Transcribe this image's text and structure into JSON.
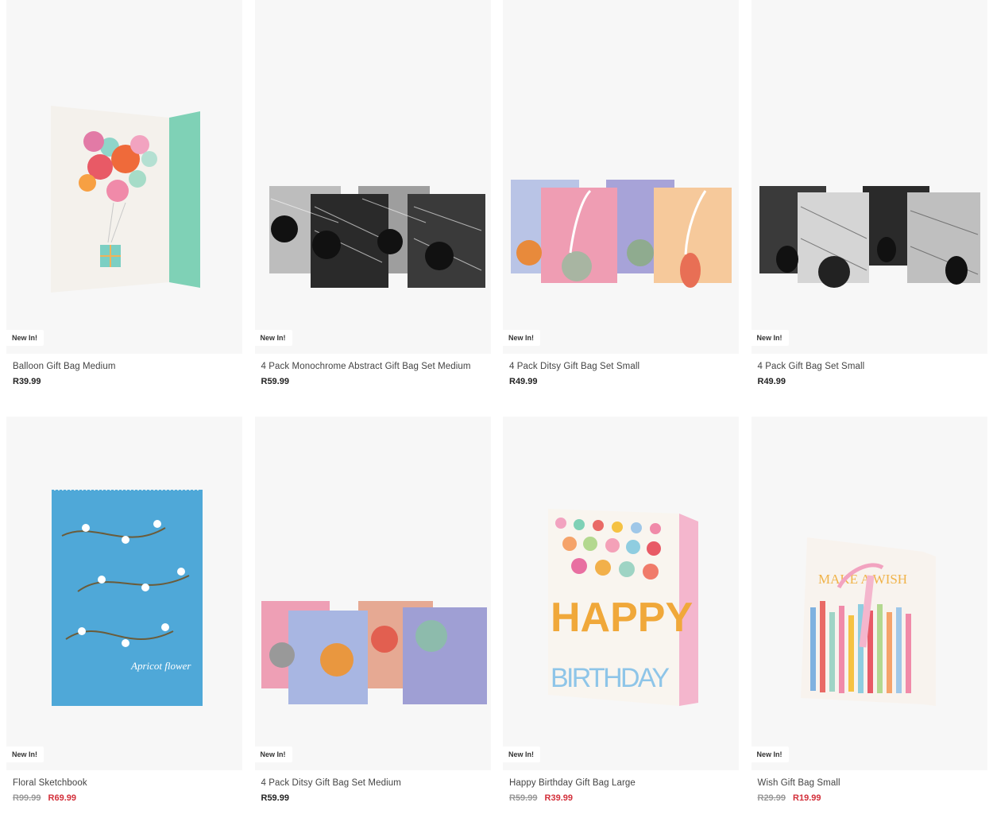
{
  "products": [
    {
      "name": "Balloon Gift Bag Medium",
      "badge": "New In!",
      "price": "R39.99",
      "was": "",
      "now": ""
    },
    {
      "name": "4 Pack Monochrome Abstract Gift Bag Set Medium",
      "badge": "New In!",
      "price": "R59.99",
      "was": "",
      "now": ""
    },
    {
      "name": "4 Pack Ditsy Gift Bag Set Small",
      "badge": "New In!",
      "price": "R49.99",
      "was": "",
      "now": ""
    },
    {
      "name": "4 Pack Gift Bag Set Small",
      "badge": "New In!",
      "price": "R49.99",
      "was": "",
      "now": ""
    },
    {
      "name": "Floral Sketchbook",
      "badge": "New In!",
      "price": "",
      "was": "R99.99",
      "now": "R69.99"
    },
    {
      "name": "4 Pack Ditsy Gift Bag Set Medium",
      "badge": "New In!",
      "price": "R59.99",
      "was": "",
      "now": ""
    },
    {
      "name": "Happy Birthday Gift Bag Large",
      "badge": "New In!",
      "price": "",
      "was": "R59.99",
      "now": "R39.99"
    },
    {
      "name": "Wish Gift Bag Small",
      "badge": "New In!",
      "price": "",
      "was": "R29.99",
      "now": "R19.99"
    }
  ],
  "product_images": {
    "sketchbook_text": "Apricot flower",
    "happy_text": "HAPPY",
    "birthday_text": "BIRTHDAY",
    "wish_text": "MAKE A WISH"
  },
  "colors": {
    "sale_price": "#d32f3a",
    "was_price": "#999999",
    "image_bg": "#f7f7f7"
  }
}
